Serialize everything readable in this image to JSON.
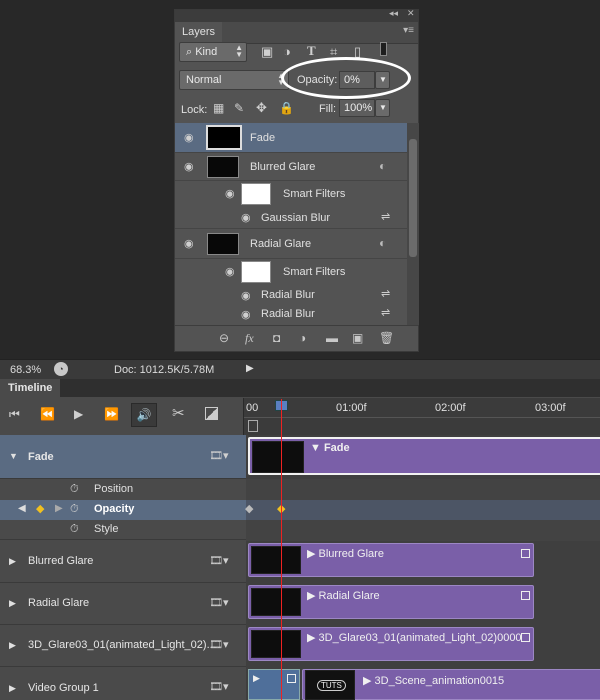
{
  "layers_panel": {
    "collapse_label": "◂◂",
    "close_label": "✕",
    "tab_label": "Layers",
    "menu_icon": "panel-menu-icon",
    "filter": {
      "kind_label": "Kind"
    },
    "blend_mode": "Normal",
    "opacity_label": "Opacity:",
    "opacity_value": "0%",
    "lock_label": "Lock:",
    "fill_label": "Fill:",
    "fill_value": "100%",
    "layers": [
      {
        "name": "Fade",
        "selected": true
      },
      {
        "name": "Blurred Glare"
      },
      {
        "name": "Smart Filters"
      },
      {
        "name": "Gaussian Blur"
      },
      {
        "name": "Radial Glare"
      },
      {
        "name": "Smart Filters"
      },
      {
        "name": "Radial Blur"
      },
      {
        "name": "Radial Blur"
      }
    ],
    "fx_label": "fx"
  },
  "status_bar": {
    "zoom": "68.3%",
    "doc": "Doc: 1012.5K/5.78M"
  },
  "timeline": {
    "tab_label": "Timeline",
    "ruler_ticks": [
      "00",
      "01:00f",
      "02:00f",
      "03:00f"
    ],
    "tracks": [
      {
        "name": "Fade",
        "clip": "Fade"
      },
      {
        "name": "Blurred Glare",
        "clip": "Blurred Glare"
      },
      {
        "name": "Radial Glare",
        "clip": "Radial Glare"
      },
      {
        "name": "3D_Glare03_01(animated_Light_02)...",
        "clip": "3D_Glare03_01(animated_Light_02)0000"
      },
      {
        "name": "Video Group 1",
        "clip": "3D_Scene_animation0015"
      }
    ],
    "properties": [
      "Position",
      "Opacity",
      "Style"
    ],
    "clip_logo": "TUTS"
  },
  "colors": {
    "clip_purple": "#7a5fa8",
    "selected_row": "#5a6b82",
    "playhead": "#e22222",
    "keyframe": "#f0c020"
  }
}
